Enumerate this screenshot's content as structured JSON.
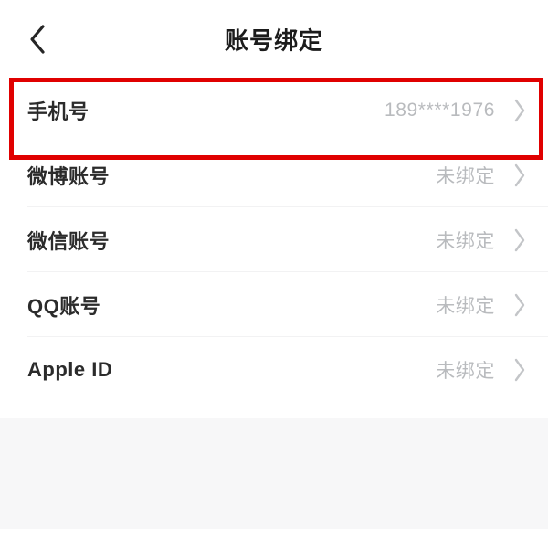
{
  "app": {
    "screen_title": "账号绑定",
    "background_color": "#ffffff",
    "panel_color": "#f7f7f8"
  },
  "navbar": {
    "back_icon": "chevron-left-icon",
    "title": "账号绑定"
  },
  "list": {
    "rows": [
      {
        "label": "手机号",
        "value": "189****1976",
        "chevron": "chevron-right-icon",
        "highlighted": true
      },
      {
        "label": "微博账号",
        "value": "未绑定",
        "chevron": "chevron-right-icon",
        "highlighted": false
      },
      {
        "label": "微信账号",
        "value": "未绑定",
        "chevron": "chevron-right-icon",
        "highlighted": false
      },
      {
        "label": "QQ账号",
        "value": "未绑定",
        "chevron": "chevron-right-icon",
        "highlighted": false
      },
      {
        "label": "Apple ID",
        "value": "未绑定",
        "chevron": "chevron-right-icon",
        "highlighted": false
      }
    ]
  },
  "annotation": {
    "type": "highlight-rectangle",
    "color": "#e00000",
    "target_row_label": "手机号"
  }
}
